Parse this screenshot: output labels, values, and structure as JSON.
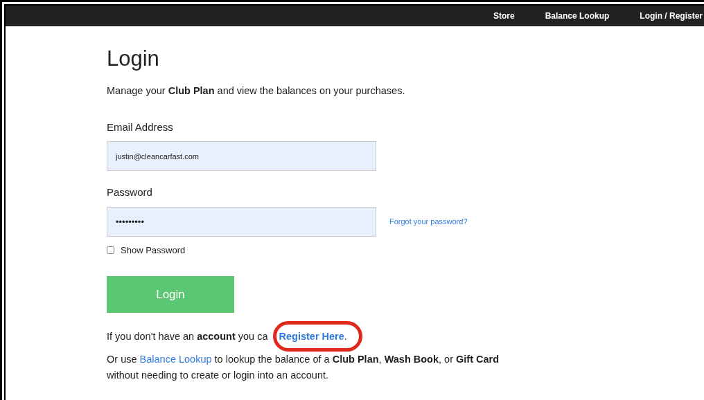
{
  "nav": {
    "links": [
      {
        "label": "Store"
      },
      {
        "label": "Balance Lookup"
      },
      {
        "label": "Login / Register"
      }
    ]
  },
  "heading": "Login",
  "intro": "Manage your **Club Plan** and view the balances on your purchases.",
  "form": {
    "email": {
      "label": "Email Address",
      "value": "justin@cleancarfast.com"
    },
    "password": {
      "label": "Password",
      "value": "•••••••••"
    },
    "forgot_link": "Forgot your password?",
    "show_password": {
      "label": "Show Password",
      "checked": false
    },
    "submit": "Login"
  },
  "register_line": {
    "text": "If you don't have an **account** you ca",
    "link": "Register Here",
    "end": "."
  },
  "balance_line": {
    "before": "Or use",
    "link": "Balance Lookup",
    "after": "to lookup the balance of a **Club Plan**, **Wash Book**, or **Gift Card** without needing to create or login into an account."
  }
}
